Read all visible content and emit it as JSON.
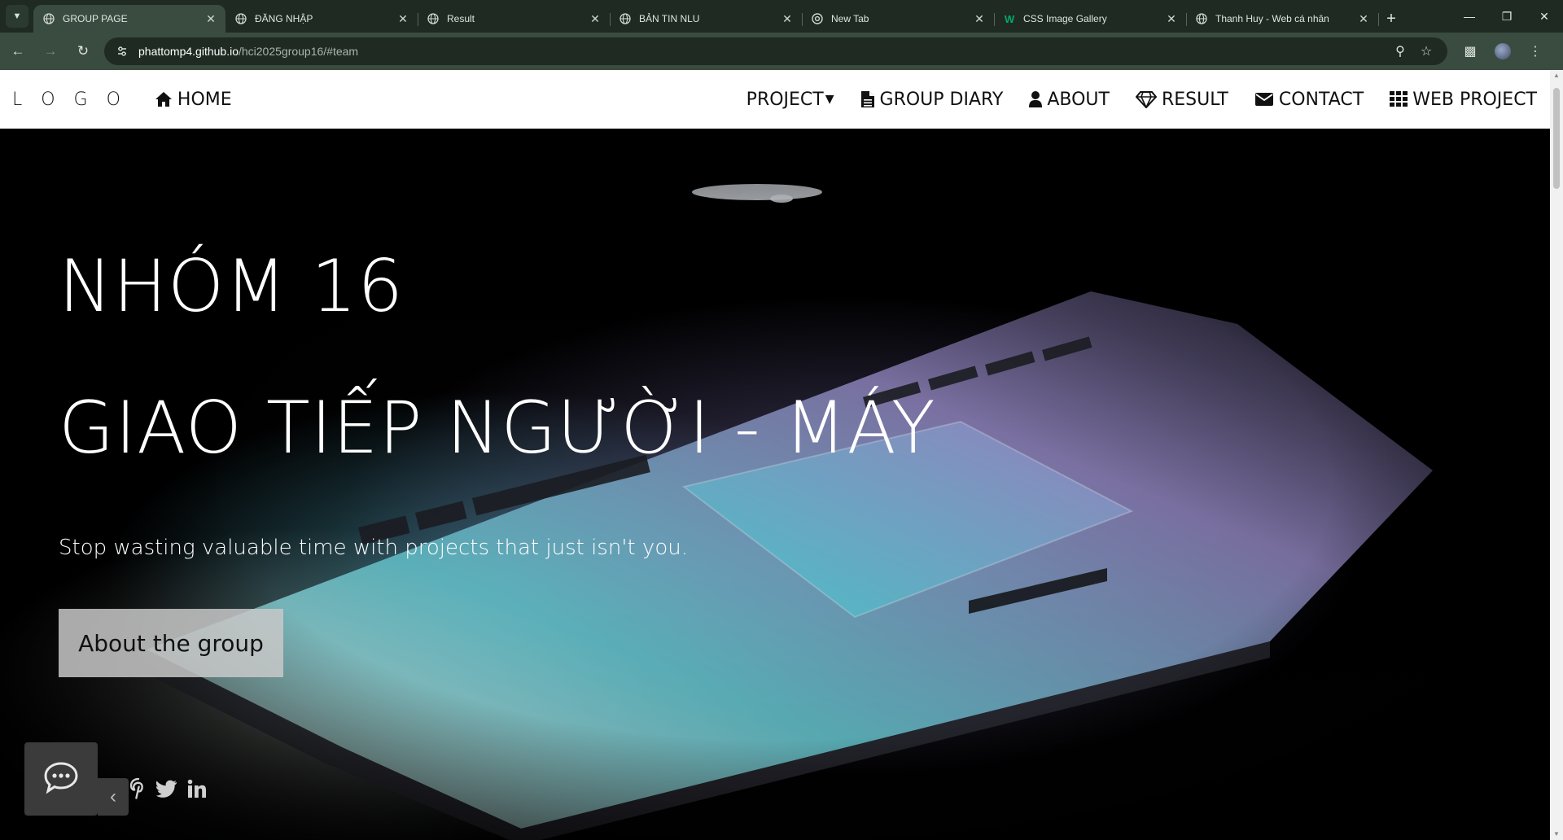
{
  "browser": {
    "tabs": [
      {
        "title": "GROUP PAGE",
        "favicon": "globe-icon",
        "active": true
      },
      {
        "title": "ĐĂNG NHẬP",
        "favicon": "globe-icon",
        "active": false
      },
      {
        "title": "Result",
        "favicon": "globe-icon",
        "active": false
      },
      {
        "title": "BẢN TIN NLU",
        "favicon": "globe-icon",
        "active": false
      },
      {
        "title": "New Tab",
        "favicon": "chrome-icon",
        "active": false
      },
      {
        "title": "CSS Image Gallery",
        "favicon": "w3schools-icon",
        "active": false
      },
      {
        "title": "Thanh Huy - Web cá nhân",
        "favicon": "globe-icon",
        "active": false
      }
    ],
    "url_host": "phattomp4.github.io",
    "url_path": "/hci2025group16/#team"
  },
  "nav": {
    "logo": "L O G O",
    "home": "HOME",
    "project": "PROJECT",
    "group_diary": "GROUP DIARY",
    "about": "ABOUT",
    "result": "RESULT",
    "contact": "CONTACT",
    "web_project": "WEB PROJECT"
  },
  "hero": {
    "title": "NHÓM 16",
    "subtitle": "GIAO TIẾP NGƯỜI - MÁY",
    "tagline": "Stop wasting valuable time with projects that just isn't you.",
    "cta": "About the group"
  },
  "social": [
    "pinterest-icon",
    "twitter-icon",
    "linkedin-icon"
  ],
  "colors": {
    "chrome_bg": "#1e2a22",
    "chrome_active": "#3a4b40",
    "nav_bg": "#ffffff",
    "hero_bg": "#000000",
    "cta_bg": "#c8c8c8"
  }
}
